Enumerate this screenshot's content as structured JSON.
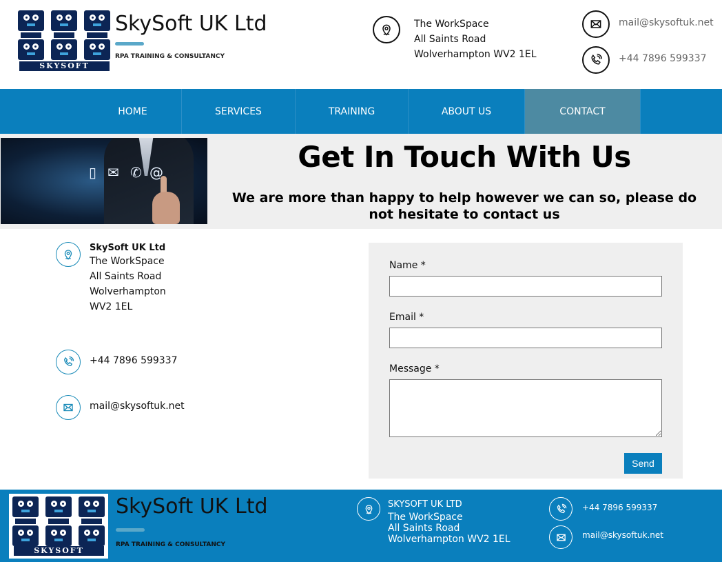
{
  "brand": {
    "name": "SkySoft UK Ltd",
    "tagline": "RPA TRAINING & CONSULTANCY",
    "logo_text": "SKYSOFT",
    "accent_color": "#0a7fbd"
  },
  "header": {
    "address_lines": [
      "The WorkSpace",
      "All Saints Road",
      "Wolverhampton WV2 1EL"
    ],
    "email": "mail@skysoftuk.net",
    "phone": "+44 7896 599337",
    "icons": [
      "location-icon",
      "email-icon",
      "phone-icon"
    ]
  },
  "nav": {
    "items": [
      {
        "label": "HOME"
      },
      {
        "label": "SERVICES"
      },
      {
        "label": "TRAINING"
      },
      {
        "label": "ABOUT US"
      },
      {
        "label": "CONTACT"
      }
    ],
    "active": "CONTACT"
  },
  "banner": {
    "title": "Get In Touch With Us",
    "subtitle": "We are more than happy to help however we can so, please do not hesitate to contact us"
  },
  "contact_info": {
    "company": "SkySoft UK Ltd",
    "address_lines": [
      "The WorkSpace",
      "All Saints Road",
      "Wolverhampton",
      "WV2 1EL"
    ],
    "phone": "+44 7896 599337",
    "email": "mail@skysoftuk.net"
  },
  "form": {
    "name_label": "Name *",
    "name_value": "",
    "email_label": "Email *",
    "email_value": "",
    "message_label": "Message *",
    "message_value": "",
    "send_label": "Send"
  },
  "footer": {
    "brand_name": "SkySoft UK Ltd",
    "tagline": "RPA TRAINING & CONSULTANCY",
    "company_caps": "SKYSOFT UK LTD",
    "address_lines": [
      "The WorkSpace",
      "All Saints Road",
      "Wolverhampton WV2 1EL"
    ],
    "phone": "+44 7896 599337",
    "email": "mail@skysoftuk.net"
  }
}
